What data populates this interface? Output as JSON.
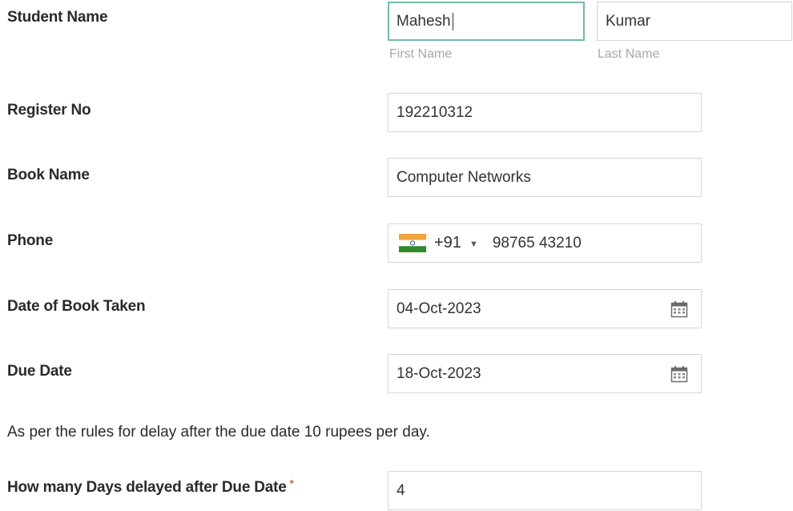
{
  "student_name": {
    "label": "Student Name",
    "first_value": "Mahesh",
    "last_value": "Kumar",
    "first_sublabel": "First Name",
    "last_sublabel": "Last Name"
  },
  "register_no": {
    "label": "Register No",
    "value": "192210312"
  },
  "book_name": {
    "label": "Book Name",
    "value": "Computer Networks"
  },
  "phone": {
    "label": "Phone",
    "country_flag": "india-flag-icon",
    "country_code": "+91",
    "number": "98765 43210"
  },
  "date_taken": {
    "label": "Date of Book Taken",
    "value": "04-Oct-2023",
    "icon": "calendar-icon"
  },
  "due_date": {
    "label": "Due Date",
    "value": "18-Oct-2023",
    "icon": "calendar-icon"
  },
  "rules_note": "As per the rules for delay after the due date 10 rupees per day.",
  "days_delayed": {
    "label": "How many Days delayed after Due Date",
    "required_marker": "*",
    "value": "4"
  },
  "colors": {
    "focus_border": "#74b9a8",
    "field_border": "#d6d6d6",
    "sublabel": "#a8a8a8",
    "required": "#d9534f"
  }
}
